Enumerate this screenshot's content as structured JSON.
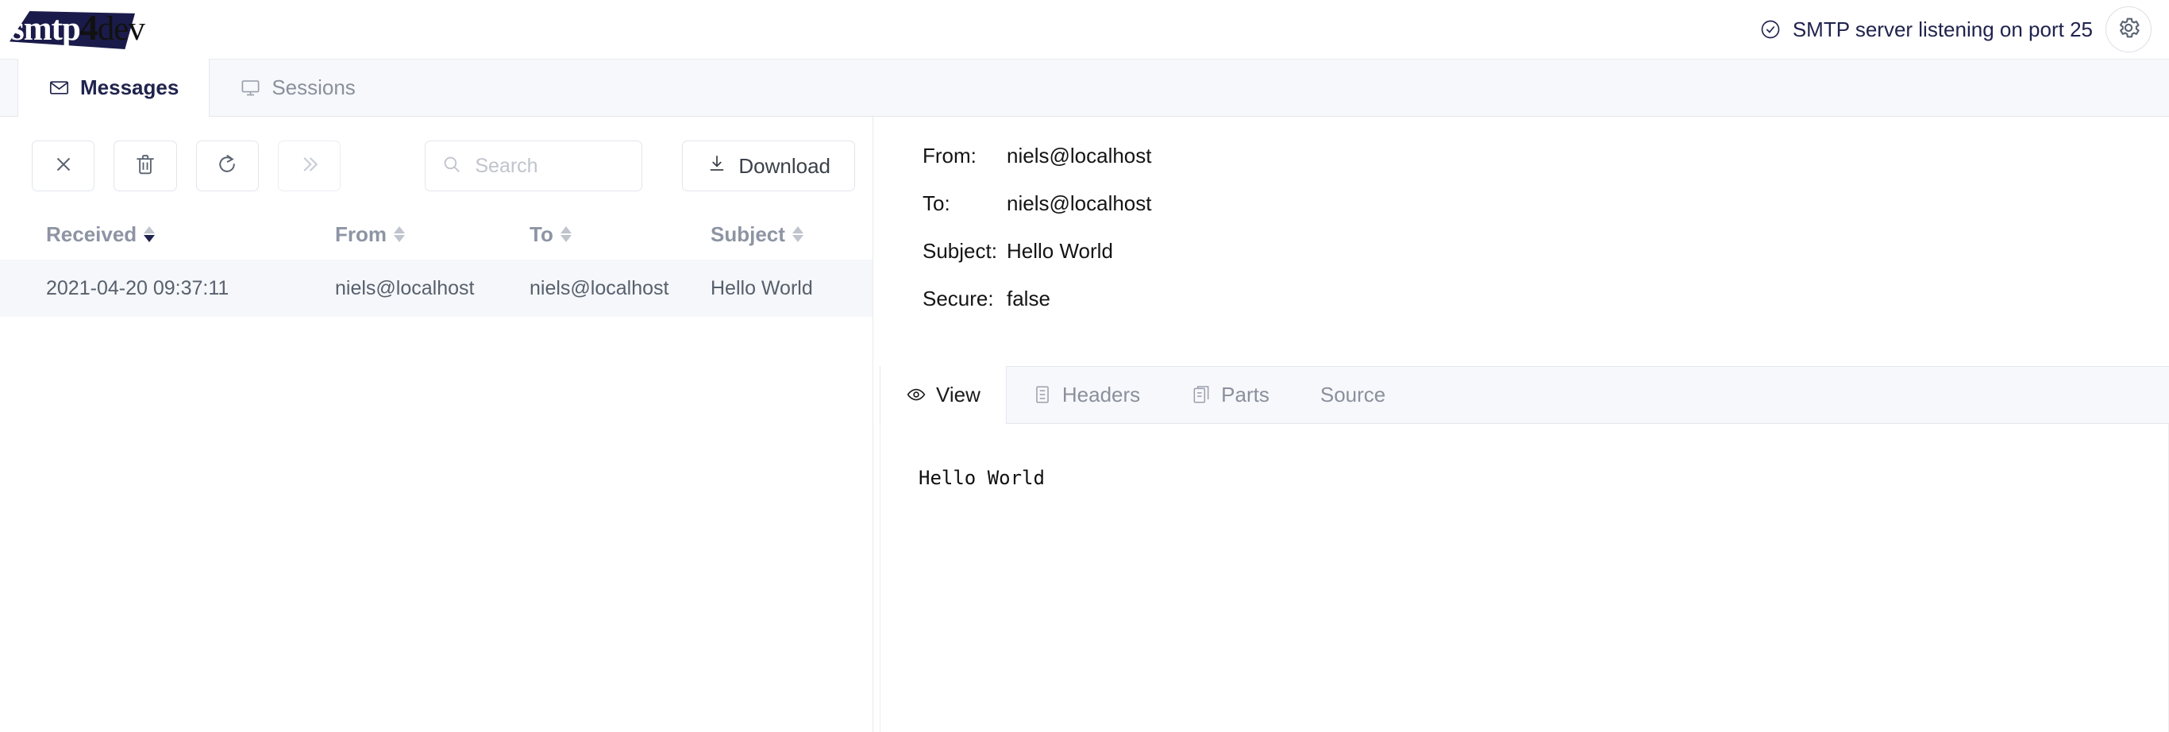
{
  "app": {
    "logo_smtp": "smtp",
    "logo_four": "4",
    "logo_dev": "dev",
    "brand_color": "#1b1b4b"
  },
  "header": {
    "status_text": "SMTP server listening on port 25",
    "status_icon": "circle-check-icon",
    "settings_icon": "gear-icon"
  },
  "tabs": {
    "items": [
      {
        "label": "Messages",
        "icon": "envelope-icon",
        "active": true
      },
      {
        "label": "Sessions",
        "icon": "monitor-icon",
        "active": false
      }
    ]
  },
  "toolbar": {
    "close_label": "",
    "close_icon": "close-icon",
    "delete_icon": "trash-icon",
    "refresh_icon": "refresh-icon",
    "expand_icon": "double-chevron-right-icon",
    "search_placeholder": "Search",
    "search_value": "",
    "search_icon": "search-icon",
    "download_label": "Download",
    "download_icon": "download-icon"
  },
  "message_list": {
    "columns": [
      {
        "key": "received",
        "label": "Received",
        "sorted": "desc"
      },
      {
        "key": "from",
        "label": "From",
        "sorted": "none"
      },
      {
        "key": "to",
        "label": "To",
        "sorted": "none"
      },
      {
        "key": "subject",
        "label": "Subject",
        "sorted": "none"
      }
    ],
    "rows": [
      {
        "received": "2021-04-20 09:37:11",
        "from": "niels@localhost",
        "to": "niels@localhost",
        "subject": "Hello World",
        "selected": true
      }
    ]
  },
  "detail": {
    "fields": [
      {
        "label": "From:",
        "value": "niels@localhost"
      },
      {
        "label": "To:",
        "value": "niels@localhost"
      },
      {
        "label": "Subject:",
        "value": "Hello World"
      },
      {
        "label": "Secure:",
        "value": "false"
      }
    ],
    "tabs": [
      {
        "label": "View",
        "icon": "eye-icon",
        "active": true
      },
      {
        "label": "Headers",
        "icon": "list-icon",
        "active": false
      },
      {
        "label": "Parts",
        "icon": "document-copy-icon",
        "active": false
      },
      {
        "label": "Source",
        "icon": "",
        "active": false
      }
    ],
    "body": "Hello World"
  }
}
